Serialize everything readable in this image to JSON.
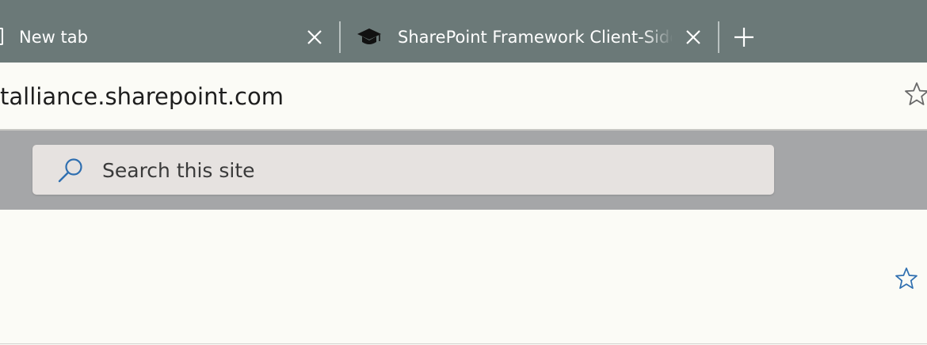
{
  "tabs": [
    {
      "label": "New tab",
      "icon": "page-icon"
    },
    {
      "label": "SharePoint Framework Client-Side Web Parts",
      "icon": "graduation-cap-icon"
    }
  ],
  "new_tab_icon": "plus-icon",
  "address": {
    "url": "talliance.sharepoint.com",
    "favorite_icon": "star-outline-icon"
  },
  "search": {
    "placeholder": "Search this site",
    "icon": "search-icon"
  },
  "content": {
    "follow_icon": "star-outline-icon"
  },
  "colors": {
    "tabstrip": "#6b7978",
    "band": "#a5a6a8",
    "searchbox": "#e6e2e0",
    "accent": "#2f6fb0"
  }
}
